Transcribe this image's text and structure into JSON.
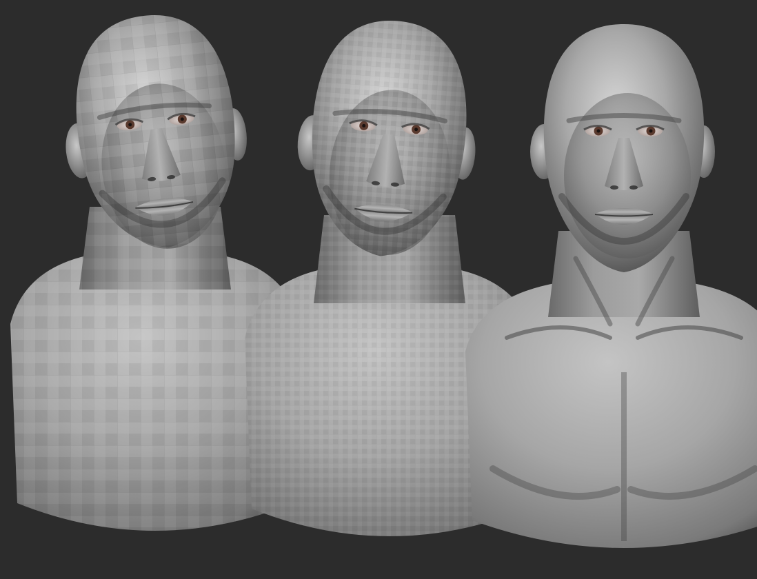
{
  "scene": {
    "background_color": "#2c2c2c",
    "clay_color": "#9a9a9a",
    "eye_iris_color": "#5a3a2e",
    "sculpts": [
      {
        "name": "bust-low-poly",
        "level": "low",
        "facet_size": 34
      },
      {
        "name": "bust-mid-poly",
        "level": "mid",
        "facet_size": 14
      },
      {
        "name": "bust-high-detail",
        "level": "high",
        "facet_size": 0
      }
    ]
  }
}
